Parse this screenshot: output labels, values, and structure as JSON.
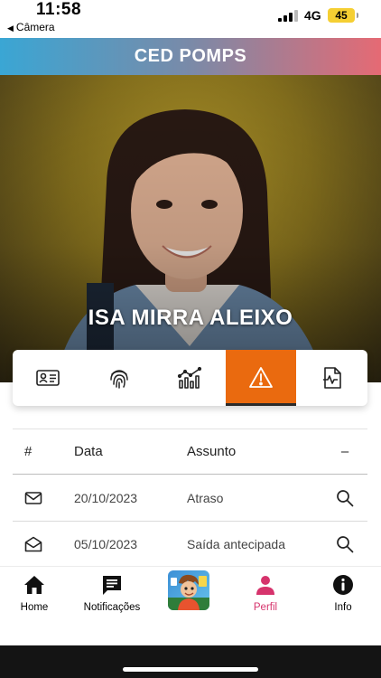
{
  "status_bar": {
    "time": "11:58",
    "back_app": "Câmera",
    "network": "4G",
    "battery": "45"
  },
  "header": {
    "title": "CED POMPS"
  },
  "profile": {
    "student_name": "ISA MIRRA ALEIXO"
  },
  "tabs": [
    {
      "icon": "id-card-icon",
      "active": false
    },
    {
      "icon": "fingerprint-icon",
      "active": false
    },
    {
      "icon": "chart-icon",
      "active": false
    },
    {
      "icon": "warning-icon",
      "active": true
    },
    {
      "icon": "health-document-icon",
      "active": false
    }
  ],
  "table": {
    "headers": {
      "num": "#",
      "date": "Data",
      "subject": "Assunto",
      "action": "–"
    },
    "rows": [
      {
        "icon": "envelope-closed-icon",
        "date": "20/10/2023",
        "subject": "Atraso"
      },
      {
        "icon": "envelope-open-icon",
        "date": "05/10/2023",
        "subject": "Saída antecipada"
      }
    ]
  },
  "bottom_nav": {
    "home": "Home",
    "notifications": "Notificações",
    "profile": "Perfil",
    "info": "Info"
  },
  "colors": {
    "active_tab": "#ea6a0f",
    "active_nav": "#d6336c",
    "header_gradient_start": "#3aa6d4",
    "header_gradient_end": "#e56a74"
  }
}
